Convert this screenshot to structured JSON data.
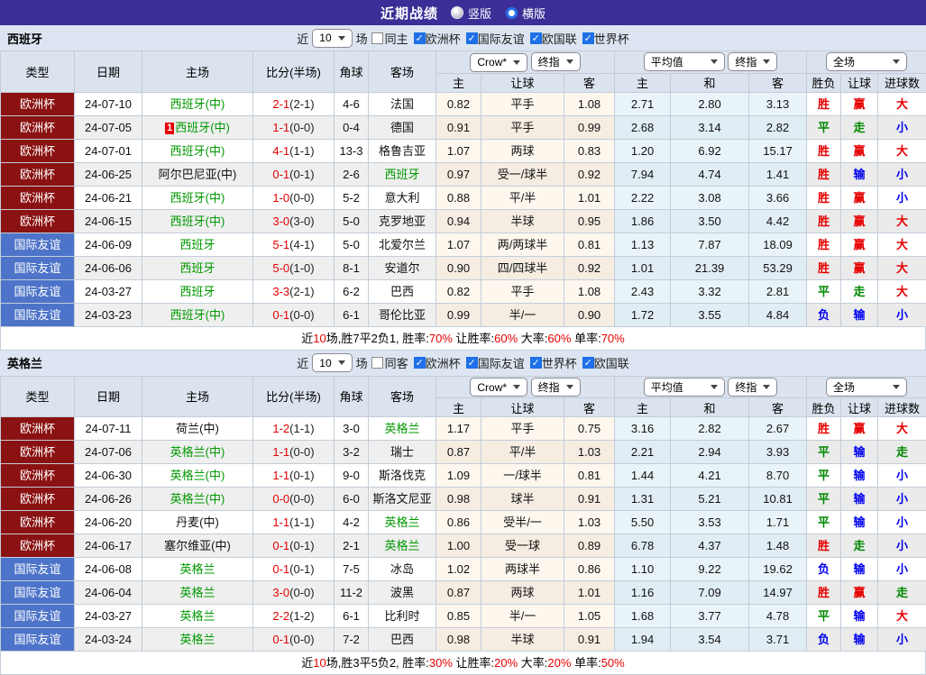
{
  "topbar": {
    "title": "近期战绩",
    "options": [
      {
        "label": "竖版",
        "selected": false
      },
      {
        "label": "横版",
        "selected": true
      }
    ]
  },
  "colors": {
    "top_bar": "#3B2F97",
    "euro_cup_bg": "#8B1212",
    "friendly_bg": "#4E74C9",
    "team_green": "#009900",
    "score_red": "#E60000",
    "win_red": "#E60000",
    "draw_green": "#008800",
    "lose_blue": "#0000EE",
    "checkbox_blue": "#1E70E8"
  },
  "table_headers": {
    "left": [
      "类型",
      "日期",
      "主场",
      "比分(半场)",
      "角球",
      "客场"
    ],
    "sub": [
      "主",
      "让球",
      "客",
      "主",
      "和",
      "客",
      "胜负",
      "让球",
      "进球数"
    ],
    "dropdowns": {
      "odds": [
        "Crow*",
        "终指"
      ],
      "avg": [
        "平均值",
        "终指"
      ],
      "scope": [
        "全场"
      ]
    }
  },
  "sections": [
    {
      "key": "spain",
      "team": "西班牙",
      "filter": {
        "near_label": "近",
        "count": "10",
        "matches_label": "场",
        "same_label": "同主",
        "same_checked": false,
        "leagues": [
          {
            "label": "欧洲杯",
            "checked": true
          },
          {
            "label": "国际友谊",
            "checked": true
          },
          {
            "label": "欧国联",
            "checked": true
          },
          {
            "label": "世界杯",
            "checked": true
          }
        ]
      },
      "rows": [
        {
          "type": "欧洲杯",
          "tc": "euro",
          "date": "24-07-10",
          "home": "西班牙(中)",
          "hg": 1,
          "badge": "",
          "score": "2-1",
          "half": "(2-1)",
          "corner": "4-6",
          "away": "法国",
          "ag": 0,
          "odds": [
            "0.82",
            "平手",
            "1.08"
          ],
          "avg": [
            "2.71",
            "2.80",
            "3.13"
          ],
          "res": [
            [
              "胜",
              "r"
            ],
            [
              "赢",
              "r"
            ],
            [
              "大",
              "r"
            ]
          ]
        },
        {
          "type": "欧洲杯",
          "tc": "euro",
          "date": "24-07-05",
          "home": "西班牙(中)",
          "hg": 1,
          "badge": "1",
          "score": "1-1",
          "half": "(0-0)",
          "corner": "0-4",
          "away": "德国",
          "ag": 0,
          "odds": [
            "0.91",
            "平手",
            "0.99"
          ],
          "avg": [
            "2.68",
            "3.14",
            "2.82"
          ],
          "res": [
            [
              "平",
              "g"
            ],
            [
              "走",
              "g"
            ],
            [
              "小",
              "b"
            ]
          ]
        },
        {
          "type": "欧洲杯",
          "tc": "euro",
          "date": "24-07-01",
          "home": "西班牙(中)",
          "hg": 1,
          "badge": "",
          "score": "4-1",
          "half": "(1-1)",
          "corner": "13-3",
          "away": "格鲁吉亚",
          "ag": 0,
          "odds": [
            "1.07",
            "两球",
            "0.83"
          ],
          "avg": [
            "1.20",
            "6.92",
            "15.17"
          ],
          "res": [
            [
              "胜",
              "r"
            ],
            [
              "赢",
              "r"
            ],
            [
              "大",
              "r"
            ]
          ]
        },
        {
          "type": "欧洲杯",
          "tc": "euro",
          "date": "24-06-25",
          "home": "阿尔巴尼亚(中)",
          "hg": 0,
          "badge": "",
          "score": "0-1",
          "half": "(0-1)",
          "corner": "2-6",
          "away": "西班牙",
          "ag": 1,
          "odds": [
            "0.97",
            "受一/球半",
            "0.92"
          ],
          "avg": [
            "7.94",
            "4.74",
            "1.41"
          ],
          "res": [
            [
              "胜",
              "r"
            ],
            [
              "输",
              "b"
            ],
            [
              "小",
              "b"
            ]
          ]
        },
        {
          "type": "欧洲杯",
          "tc": "euro",
          "date": "24-06-21",
          "home": "西班牙(中)",
          "hg": 1,
          "badge": "",
          "score": "1-0",
          "half": "(0-0)",
          "corner": "5-2",
          "away": "意大利",
          "ag": 0,
          "odds": [
            "0.88",
            "平/半",
            "1.01"
          ],
          "avg": [
            "2.22",
            "3.08",
            "3.66"
          ],
          "res": [
            [
              "胜",
              "r"
            ],
            [
              "赢",
              "r"
            ],
            [
              "小",
              "b"
            ]
          ]
        },
        {
          "type": "欧洲杯",
          "tc": "euro",
          "date": "24-06-15",
          "home": "西班牙(中)",
          "hg": 1,
          "badge": "",
          "score": "3-0",
          "half": "(3-0)",
          "corner": "5-0",
          "away": "克罗地亚",
          "ag": 0,
          "odds": [
            "0.94",
            "半球",
            "0.95"
          ],
          "avg": [
            "1.86",
            "3.50",
            "4.42"
          ],
          "res": [
            [
              "胜",
              "r"
            ],
            [
              "赢",
              "r"
            ],
            [
              "大",
              "r"
            ]
          ]
        },
        {
          "type": "国际友谊",
          "tc": "fr",
          "date": "24-06-09",
          "home": "西班牙",
          "hg": 1,
          "badge": "",
          "score": "5-1",
          "half": "(4-1)",
          "corner": "5-0",
          "away": "北爱尔兰",
          "ag": 0,
          "odds": [
            "1.07",
            "两/两球半",
            "0.81"
          ],
          "avg": [
            "1.13",
            "7.87",
            "18.09"
          ],
          "res": [
            [
              "胜",
              "r"
            ],
            [
              "赢",
              "r"
            ],
            [
              "大",
              "r"
            ]
          ]
        },
        {
          "type": "国际友谊",
          "tc": "fr",
          "date": "24-06-06",
          "home": "西班牙",
          "hg": 1,
          "badge": "",
          "score": "5-0",
          "half": "(1-0)",
          "corner": "8-1",
          "away": "安道尔",
          "ag": 0,
          "odds": [
            "0.90",
            "四/四球半",
            "0.92"
          ],
          "avg": [
            "1.01",
            "21.39",
            "53.29"
          ],
          "res": [
            [
              "胜",
              "r"
            ],
            [
              "赢",
              "r"
            ],
            [
              "大",
              "r"
            ]
          ]
        },
        {
          "type": "国际友谊",
          "tc": "fr",
          "date": "24-03-27",
          "home": "西班牙",
          "hg": 1,
          "badge": "",
          "score": "3-3",
          "half": "(2-1)",
          "corner": "6-2",
          "away": "巴西",
          "ag": 0,
          "odds": [
            "0.82",
            "平手",
            "1.08"
          ],
          "avg": [
            "2.43",
            "3.32",
            "2.81"
          ],
          "res": [
            [
              "平",
              "g"
            ],
            [
              "走",
              "g"
            ],
            [
              "大",
              "r"
            ]
          ]
        },
        {
          "type": "国际友谊",
          "tc": "fr",
          "date": "24-03-23",
          "home": "西班牙(中)",
          "hg": 1,
          "badge": "",
          "score": "0-1",
          "half": "(0-0)",
          "corner": "6-1",
          "away": "哥伦比亚",
          "ag": 0,
          "odds": [
            "0.99",
            "半/一",
            "0.90"
          ],
          "avg": [
            "1.72",
            "3.55",
            "4.84"
          ],
          "res": [
            [
              "负",
              "b"
            ],
            [
              "输",
              "b"
            ],
            [
              "小",
              "b"
            ]
          ]
        }
      ],
      "summary": [
        [
          "近",
          0
        ],
        [
          "10",
          1
        ],
        [
          "场,胜7平2负1, 胜率:",
          0
        ],
        [
          "70%",
          1
        ],
        [
          " 让胜率:",
          0
        ],
        [
          "60%",
          1
        ],
        [
          " 大率:",
          0
        ],
        [
          "60%",
          1
        ],
        [
          " 单率:",
          0
        ],
        [
          "70%",
          1
        ]
      ]
    },
    {
      "key": "england",
      "team": "英格兰",
      "filter": {
        "near_label": "近",
        "count": "10",
        "matches_label": "场",
        "same_label": "同客",
        "same_checked": false,
        "leagues": [
          {
            "label": "欧洲杯",
            "checked": true
          },
          {
            "label": "国际友谊",
            "checked": true
          },
          {
            "label": "世界杯",
            "checked": true
          },
          {
            "label": "欧国联",
            "checked": true
          }
        ]
      },
      "rows": [
        {
          "type": "欧洲杯",
          "tc": "euro",
          "date": "24-07-11",
          "home": "荷兰(中)",
          "hg": 0,
          "badge": "",
          "score": "1-2",
          "half": "(1-1)",
          "corner": "3-0",
          "away": "英格兰",
          "ag": 1,
          "odds": [
            "1.17",
            "平手",
            "0.75"
          ],
          "avg": [
            "3.16",
            "2.82",
            "2.67"
          ],
          "res": [
            [
              "胜",
              "r"
            ],
            [
              "赢",
              "r"
            ],
            [
              "大",
              "r"
            ]
          ]
        },
        {
          "type": "欧洲杯",
          "tc": "euro",
          "date": "24-07-06",
          "home": "英格兰(中)",
          "hg": 1,
          "badge": "",
          "score": "1-1",
          "half": "(0-0)",
          "corner": "3-2",
          "away": "瑞士",
          "ag": 0,
          "odds": [
            "0.87",
            "平/半",
            "1.03"
          ],
          "avg": [
            "2.21",
            "2.94",
            "3.93"
          ],
          "res": [
            [
              "平",
              "g"
            ],
            [
              "输",
              "b"
            ],
            [
              "走",
              "g"
            ]
          ]
        },
        {
          "type": "欧洲杯",
          "tc": "euro",
          "date": "24-06-30",
          "home": "英格兰(中)",
          "hg": 1,
          "badge": "",
          "score": "1-1",
          "half": "(0-1)",
          "corner": "9-0",
          "away": "斯洛伐克",
          "ag": 0,
          "odds": [
            "1.09",
            "一/球半",
            "0.81"
          ],
          "avg": [
            "1.44",
            "4.21",
            "8.70"
          ],
          "res": [
            [
              "平",
              "g"
            ],
            [
              "输",
              "b"
            ],
            [
              "小",
              "b"
            ]
          ]
        },
        {
          "type": "欧洲杯",
          "tc": "euro",
          "date": "24-06-26",
          "home": "英格兰(中)",
          "hg": 1,
          "badge": "",
          "score": "0-0",
          "half": "(0-0)",
          "corner": "6-0",
          "away": "斯洛文尼亚",
          "ag": 0,
          "odds": [
            "0.98",
            "球半",
            "0.91"
          ],
          "avg": [
            "1.31",
            "5.21",
            "10.81"
          ],
          "res": [
            [
              "平",
              "g"
            ],
            [
              "输",
              "b"
            ],
            [
              "小",
              "b"
            ]
          ]
        },
        {
          "type": "欧洲杯",
          "tc": "euro",
          "date": "24-06-20",
          "home": "丹麦(中)",
          "hg": 0,
          "badge": "",
          "score": "1-1",
          "half": "(1-1)",
          "corner": "4-2",
          "away": "英格兰",
          "ag": 1,
          "odds": [
            "0.86",
            "受半/一",
            "1.03"
          ],
          "avg": [
            "5.50",
            "3.53",
            "1.71"
          ],
          "res": [
            [
              "平",
              "g"
            ],
            [
              "输",
              "b"
            ],
            [
              "小",
              "b"
            ]
          ]
        },
        {
          "type": "欧洲杯",
          "tc": "euro",
          "date": "24-06-17",
          "home": "塞尔维亚(中)",
          "hg": 0,
          "badge": "",
          "score": "0-1",
          "half": "(0-1)",
          "corner": "2-1",
          "away": "英格兰",
          "ag": 1,
          "odds": [
            "1.00",
            "受一球",
            "0.89"
          ],
          "avg": [
            "6.78",
            "4.37",
            "1.48"
          ],
          "res": [
            [
              "胜",
              "r"
            ],
            [
              "走",
              "g"
            ],
            [
              "小",
              "b"
            ]
          ]
        },
        {
          "type": "国际友谊",
          "tc": "fr",
          "date": "24-06-08",
          "home": "英格兰",
          "hg": 1,
          "badge": "",
          "score": "0-1",
          "half": "(0-1)",
          "corner": "7-5",
          "away": "冰岛",
          "ag": 0,
          "odds": [
            "1.02",
            "两球半",
            "0.86"
          ],
          "avg": [
            "1.10",
            "9.22",
            "19.62"
          ],
          "res": [
            [
              "负",
              "b"
            ],
            [
              "输",
              "b"
            ],
            [
              "小",
              "b"
            ]
          ]
        },
        {
          "type": "国际友谊",
          "tc": "fr",
          "date": "24-06-04",
          "home": "英格兰",
          "hg": 1,
          "badge": "",
          "score": "3-0",
          "half": "(0-0)",
          "corner": "11-2",
          "away": "波黑",
          "ag": 0,
          "odds": [
            "0.87",
            "两球",
            "1.01"
          ],
          "avg": [
            "1.16",
            "7.09",
            "14.97"
          ],
          "res": [
            [
              "胜",
              "r"
            ],
            [
              "赢",
              "r"
            ],
            [
              "走",
              "g"
            ]
          ]
        },
        {
          "type": "国际友谊",
          "tc": "fr",
          "date": "24-03-27",
          "home": "英格兰",
          "hg": 1,
          "badge": "",
          "score": "2-2",
          "half": "(1-2)",
          "corner": "6-1",
          "away": "比利时",
          "ag": 0,
          "odds": [
            "0.85",
            "半/一",
            "1.05"
          ],
          "avg": [
            "1.68",
            "3.77",
            "4.78"
          ],
          "res": [
            [
              "平",
              "g"
            ],
            [
              "输",
              "b"
            ],
            [
              "大",
              "r"
            ]
          ]
        },
        {
          "type": "国际友谊",
          "tc": "fr",
          "date": "24-03-24",
          "home": "英格兰",
          "hg": 1,
          "badge": "",
          "score": "0-1",
          "half": "(0-0)",
          "corner": "7-2",
          "away": "巴西",
          "ag": 0,
          "odds": [
            "0.98",
            "半球",
            "0.91"
          ],
          "avg": [
            "1.94",
            "3.54",
            "3.71"
          ],
          "res": [
            [
              "负",
              "b"
            ],
            [
              "输",
              "b"
            ],
            [
              "小",
              "b"
            ]
          ]
        }
      ],
      "summary": [
        [
          "近",
          0
        ],
        [
          "10",
          1
        ],
        [
          "场,胜3平5负2, 胜率:",
          0
        ],
        [
          "30%",
          1
        ],
        [
          " 让胜率:",
          0
        ],
        [
          "20%",
          1
        ],
        [
          " 大率:",
          0
        ],
        [
          "20%",
          1
        ],
        [
          " 单率:",
          0
        ],
        [
          "50%",
          1
        ]
      ]
    }
  ]
}
